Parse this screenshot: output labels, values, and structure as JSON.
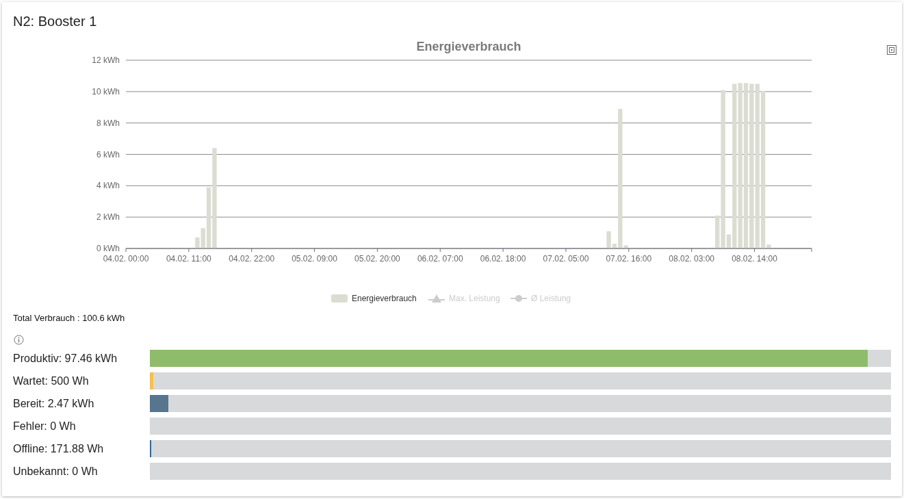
{
  "title": "N2: Booster 1",
  "chart": {
    "chart_data": {
      "type": "bar",
      "title": "Energieverbrauch",
      "categories": [
        "04.02. 00:00",
        null,
        null,
        null,
        null,
        null,
        null,
        null,
        null,
        null,
        null,
        "04.02. 11:00",
        null,
        null,
        null,
        null,
        null,
        null,
        null,
        null,
        null,
        null,
        "04.02. 22:00",
        null,
        null,
        null,
        null,
        null,
        null,
        null,
        null,
        null,
        null,
        "05.02. 09:00",
        null,
        null,
        null,
        null,
        null,
        null,
        null,
        null,
        null,
        null,
        "05.02. 20:00",
        null,
        null,
        null,
        null,
        null,
        null,
        null,
        null,
        null,
        null,
        "06.02. 07:00",
        null,
        null,
        null,
        null,
        null,
        null,
        null,
        null,
        null,
        null,
        "06.02. 18:00",
        null,
        null,
        null,
        null,
        null,
        null,
        null,
        null,
        null,
        null,
        "07.02. 05:00",
        null,
        null,
        null,
        null,
        null,
        null,
        null,
        null,
        null,
        null,
        "07.02. 16:00",
        null,
        null,
        null,
        null,
        null,
        null,
        null,
        null,
        null,
        null,
        "08.02. 03:00",
        null,
        null,
        null,
        null,
        null,
        null,
        null,
        null,
        null,
        null,
        "08.02. 14:00",
        null,
        null,
        null,
        null,
        null,
        null,
        null,
        null,
        null
      ],
      "series": [
        {
          "name": "Energieverbrauch",
          "color": "#dcddd2",
          "values": [
            0,
            0,
            0,
            0,
            0,
            0,
            0,
            0,
            0,
            0,
            0,
            0,
            0.7,
            1.3,
            3.9,
            6.4,
            0,
            0,
            0,
            0,
            0,
            0,
            0,
            0,
            0,
            0,
            0,
            0,
            0,
            0,
            0,
            0,
            0,
            0,
            0,
            0,
            0,
            0,
            0,
            0,
            0,
            0,
            0,
            0,
            0,
            0,
            0,
            0,
            0,
            0,
            0,
            0,
            0,
            0,
            0,
            0,
            0,
            0,
            0,
            0,
            0,
            0,
            0,
            0,
            0,
            0,
            0,
            0,
            0,
            0,
            0,
            0,
            0,
            0,
            0,
            0,
            0,
            0,
            0,
            0,
            0,
            0,
            0,
            0,
            1.1,
            0.3,
            8.9,
            0.2,
            0,
            0,
            0,
            0,
            0,
            0,
            0,
            0,
            0,
            0,
            0,
            0,
            0,
            0,
            0,
            2.1,
            10.1,
            0.9,
            10.5,
            10.55,
            10.55,
            10.5,
            10.5,
            10.05,
            0.25,
            0,
            0,
            0,
            0,
            0,
            0,
            0
          ]
        }
      ],
      "ylim": [
        0,
        12
      ],
      "grid": true,
      "yticks": [
        {
          "value": 0,
          "label": "0 kWh"
        },
        {
          "value": 2,
          "label": "2 kWh"
        },
        {
          "value": 4,
          "label": "4 kWh"
        },
        {
          "value": 6,
          "label": "6 kWh"
        },
        {
          "value": 8,
          "label": "8 kWh"
        },
        {
          "value": 10,
          "label": "10 kWh"
        },
        {
          "value": 12,
          "label": "12 kWh"
        }
      ]
    },
    "legend": [
      {
        "label": "Max. Leistung",
        "kind": "triangle",
        "active": false
      },
      {
        "label": "Ø Leistung",
        "kind": "circle",
        "active": false
      }
    ]
  },
  "total": "Total Verbrauch : 100.6 kWh",
  "states": [
    {
      "label": "Produktiv: 97.46 kWh",
      "level": 0.969,
      "color": "#8fbc6b"
    },
    {
      "label": "Wartet: 500 Wh",
      "level": 0.005,
      "color": "#f4c04e"
    },
    {
      "label": "Bereit: 2.47 kWh",
      "level": 0.025,
      "color": "#587590"
    },
    {
      "label": "Fehler: 0 Wh",
      "level": 0
    },
    {
      "label": "Offline: 171.88 Wh",
      "level": 0.002,
      "color": "#2f6b9a"
    },
    {
      "label": "Unbekannt: 0 Wh",
      "level": 0
    }
  ]
}
